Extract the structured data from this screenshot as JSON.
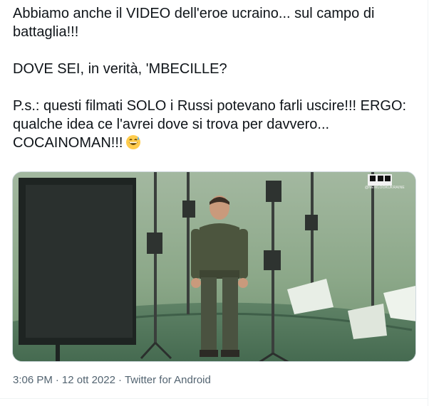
{
  "tweet": {
    "lines": [
      "Abbiamo anche il VIDEO dell'eroe ucraino... sul campo di battaglia!!!",
      "DOVE SEI, in verità, 'MBECILLE?",
      "P.s.: questi filmati SOLO i Russi potevano farli uscire!!! ERGO: qualche idea ce l'avrei dove si trova per davvero...  COCAINOMAN!!!"
    ],
    "emoji_name": "grinning-sweat-emoji",
    "media": {
      "watermark": "@NEWLOOKUKRAINE"
    },
    "time": "3:06 PM",
    "date": "12 ott 2022",
    "source": "Twitter for Android",
    "separator": "·"
  },
  "colors": {
    "text": "#0f1419",
    "meta": "#536471",
    "green_screen": "#8ea88c"
  }
}
